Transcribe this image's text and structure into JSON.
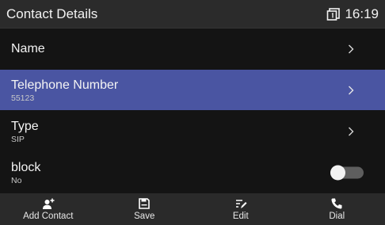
{
  "status_bar": {
    "title": "Contact Details",
    "time": "16:19",
    "indicator_icon": "line-status-icon"
  },
  "rows": [
    {
      "label": "Name",
      "value": "",
      "control": "chevron"
    },
    {
      "label": "Telephone Number",
      "value": "55123",
      "control": "chevron",
      "selected": true
    },
    {
      "label": "Type",
      "value": "SIP",
      "control": "chevron"
    },
    {
      "label": "block",
      "value": "No",
      "control": "toggle",
      "toggle_on": false
    }
  ],
  "softkeys": [
    {
      "label": "Add Contact",
      "icon": "add-contact-icon"
    },
    {
      "label": "Save",
      "icon": "save-icon"
    },
    {
      "label": "Edit",
      "icon": "edit-icon"
    },
    {
      "label": "Dial",
      "icon": "phone-icon"
    }
  ],
  "colors": {
    "selected_row": "#4a55a2",
    "background": "#141414",
    "bars": "#2a2a2a"
  }
}
